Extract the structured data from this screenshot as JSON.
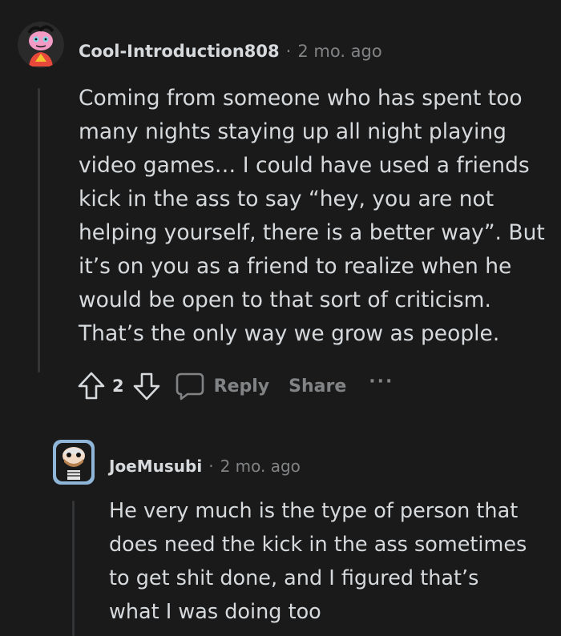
{
  "comments": [
    {
      "username": "Cool-Introduction808",
      "separator": "·",
      "time": "2 mo. ago",
      "lines": [
        "Coming from someone who has spent too",
        "many nights staying up all night playing",
        "video games… I could have used a friends",
        "kick in the ass to say “hey, you are not",
        "helping yourself, there is a better way”. But",
        "it’s on you as a friend to realize when he",
        "would be open to that sort of criticism.",
        "That’s the only way we grow as people."
      ],
      "vote_count": "2",
      "reply_label": "Reply",
      "share_label": "Share",
      "more_label": "···"
    },
    {
      "username": "JoeMusubi",
      "separator": "·",
      "time": "2 mo. ago",
      "lines": [
        "He very much is the type of person that",
        "does need the kick in the ass sometimes",
        "to get shit done, and I figured that’s",
        "what I was doing too"
      ]
    }
  ],
  "colors": {
    "background": "#1a1a1b",
    "text": "#d7dadc",
    "muted": "#818384",
    "thread_line": "#343536"
  }
}
